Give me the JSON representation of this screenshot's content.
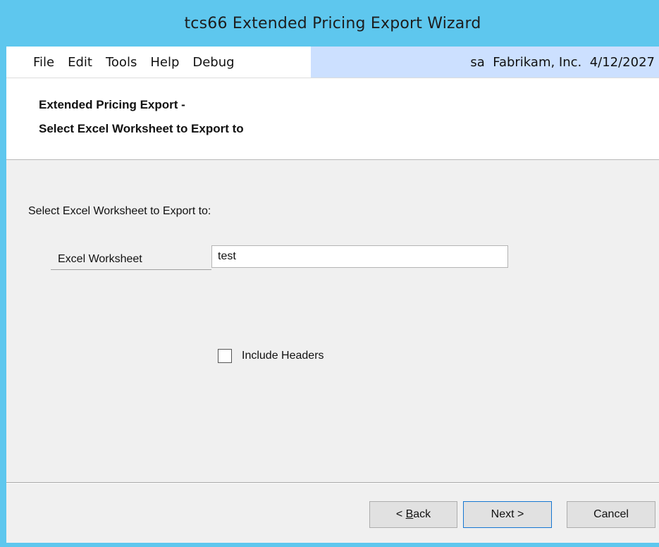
{
  "window": {
    "title": "tcs66 Extended Pricing Export Wizard"
  },
  "menu": {
    "items": [
      "File",
      "Edit",
      "Tools",
      "Help",
      "Debug"
    ],
    "status": "sa  Fabrikam, Inc.  4/12/2027"
  },
  "header": {
    "line1": "Extended Pricing Export -",
    "line2": "Select Excel Worksheet to Export to"
  },
  "form": {
    "prompt": "Select Excel Worksheet to Export to:",
    "worksheet_label": "Excel Worksheet",
    "worksheet_value": "test",
    "include_headers_label": "Include Headers",
    "include_headers_checked": false
  },
  "buttons": {
    "back_prefix": "< ",
    "back_accel": "B",
    "back_rest": "ack",
    "next": "Next >",
    "cancel": "Cancel"
  },
  "colors": {
    "title_bar": "#5ec7ee",
    "status_bg": "#cce0ff",
    "body_bg": "#f0f0f0"
  }
}
